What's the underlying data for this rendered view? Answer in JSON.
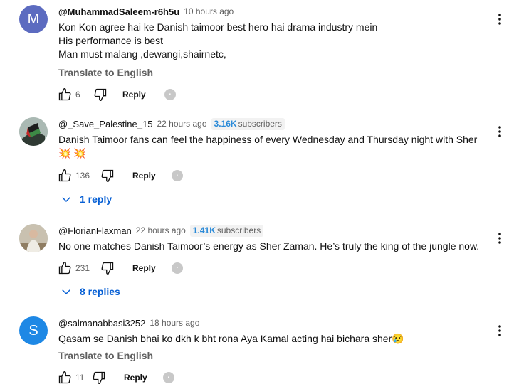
{
  "comments": [
    {
      "author": "@MuhammadSaleem-r6h5u",
      "avatar_letter": "M",
      "time": "10 hours ago",
      "subscribers": "",
      "lines": [
        "Kon Kon agree hai ke Danish taimoor best hero hai drama industry mein",
        "His performance is best",
        "Man must malang ,dewangi,shairnetc,"
      ],
      "translate": "Translate to English",
      "likes": "6",
      "reply": "Reply"
    },
    {
      "author": "@_Save_Palestine_15",
      "time": "22 hours ago",
      "subscribers_value": "3.16K",
      "subscribers_label": "subscribers",
      "lines": [
        "Danish Taimoor fans can feel the happiness of every Wednesday and Thursday night with Sher",
        "💥 💥"
      ],
      "likes": "136",
      "reply": "Reply",
      "replies": "1 reply"
    },
    {
      "author": "@FlorianFlaxman",
      "time": "22 hours ago",
      "subscribers_value": "1.41K",
      "subscribers_label": "subscribers",
      "lines": [
        "No one matches Danish Taimoor’s energy as Sher Zaman. He’s truly the king of the jungle now."
      ],
      "likes": "231",
      "reply": "Reply",
      "replies": "8 replies"
    },
    {
      "author": "@salmanabbasi3252",
      "avatar_letter": "S",
      "time": "18 hours ago",
      "lines": [
        "Qasam se Danish bhai ko dkh k bht rona Aya Kamal acting hai bichara sher😢"
      ],
      "translate": "Translate to English",
      "likes": "11",
      "reply": "Reply"
    }
  ],
  "colors": {
    "link_blue": "#065fd4",
    "muted_gray": "#606060",
    "avatar_m": "#5c6bc0",
    "avatar_s": "#1e88e5"
  },
  "icons": [
    "thumb-up-icon",
    "thumb-down-icon",
    "more-vert-icon",
    "chevron-down-icon",
    "creator-heart-icon"
  ]
}
